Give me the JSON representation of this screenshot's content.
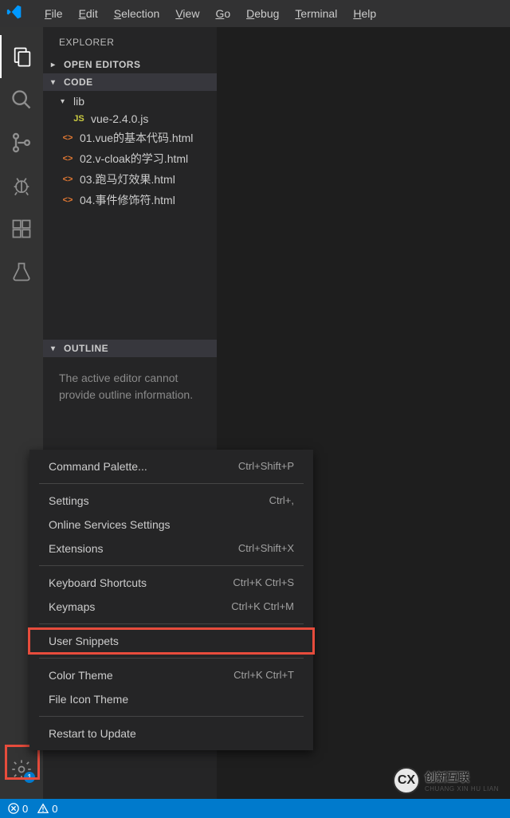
{
  "titlebar": {
    "menus": [
      {
        "label": "File",
        "mnemonic": "F"
      },
      {
        "label": "Edit",
        "mnemonic": "E"
      },
      {
        "label": "Selection",
        "mnemonic": "S"
      },
      {
        "label": "View",
        "mnemonic": "V"
      },
      {
        "label": "Go",
        "mnemonic": "G"
      },
      {
        "label": "Debug",
        "mnemonic": "D"
      },
      {
        "label": "Terminal",
        "mnemonic": "T"
      },
      {
        "label": "Help",
        "mnemonic": "H"
      }
    ]
  },
  "activitybar": {
    "items": [
      "explorer",
      "search",
      "source-control",
      "debug",
      "extensions",
      "test"
    ],
    "update_badge": "1"
  },
  "sidebar": {
    "title": "EXPLORER",
    "sections": {
      "open_editors": {
        "label": "OPEN EDITORS",
        "expanded": false
      },
      "code": {
        "label": "CODE",
        "expanded": true,
        "folders": [
          {
            "name": "lib",
            "expanded": true,
            "files": [
              {
                "name": "vue-2.4.0.js",
                "type": "js"
              }
            ]
          }
        ],
        "files": [
          {
            "name": "01.vue的基本代码.html",
            "type": "html"
          },
          {
            "name": "02.v-cloak的学习.html",
            "type": "html"
          },
          {
            "name": "03.跑马灯效果.html",
            "type": "html"
          },
          {
            "name": "04.事件修饰符.html",
            "type": "html"
          }
        ]
      },
      "outline": {
        "label": "OUTLINE",
        "expanded": true,
        "empty_message": "The active editor cannot provide outline information."
      }
    }
  },
  "context_menu": {
    "groups": [
      [
        {
          "label": "Command Palette...",
          "shortcut": "Ctrl+Shift+P"
        }
      ],
      [
        {
          "label": "Settings",
          "shortcut": "Ctrl+,"
        },
        {
          "label": "Online Services Settings",
          "shortcut": ""
        },
        {
          "label": "Extensions",
          "shortcut": "Ctrl+Shift+X"
        }
      ],
      [
        {
          "label": "Keyboard Shortcuts",
          "shortcut": "Ctrl+K Ctrl+S"
        },
        {
          "label": "Keymaps",
          "shortcut": "Ctrl+K Ctrl+M"
        }
      ],
      [
        {
          "label": "User Snippets",
          "shortcut": "",
          "highlight": true
        }
      ],
      [
        {
          "label": "Color Theme",
          "shortcut": "Ctrl+K Ctrl+T"
        },
        {
          "label": "File Icon Theme",
          "shortcut": ""
        }
      ],
      [
        {
          "label": "Restart to Update",
          "shortcut": ""
        }
      ]
    ]
  },
  "statusbar": {
    "errors": "0",
    "warnings": "0"
  },
  "watermark": {
    "initials": "CX",
    "text": "创新互联",
    "sub": "CHUANG XIN HU LIAN"
  }
}
